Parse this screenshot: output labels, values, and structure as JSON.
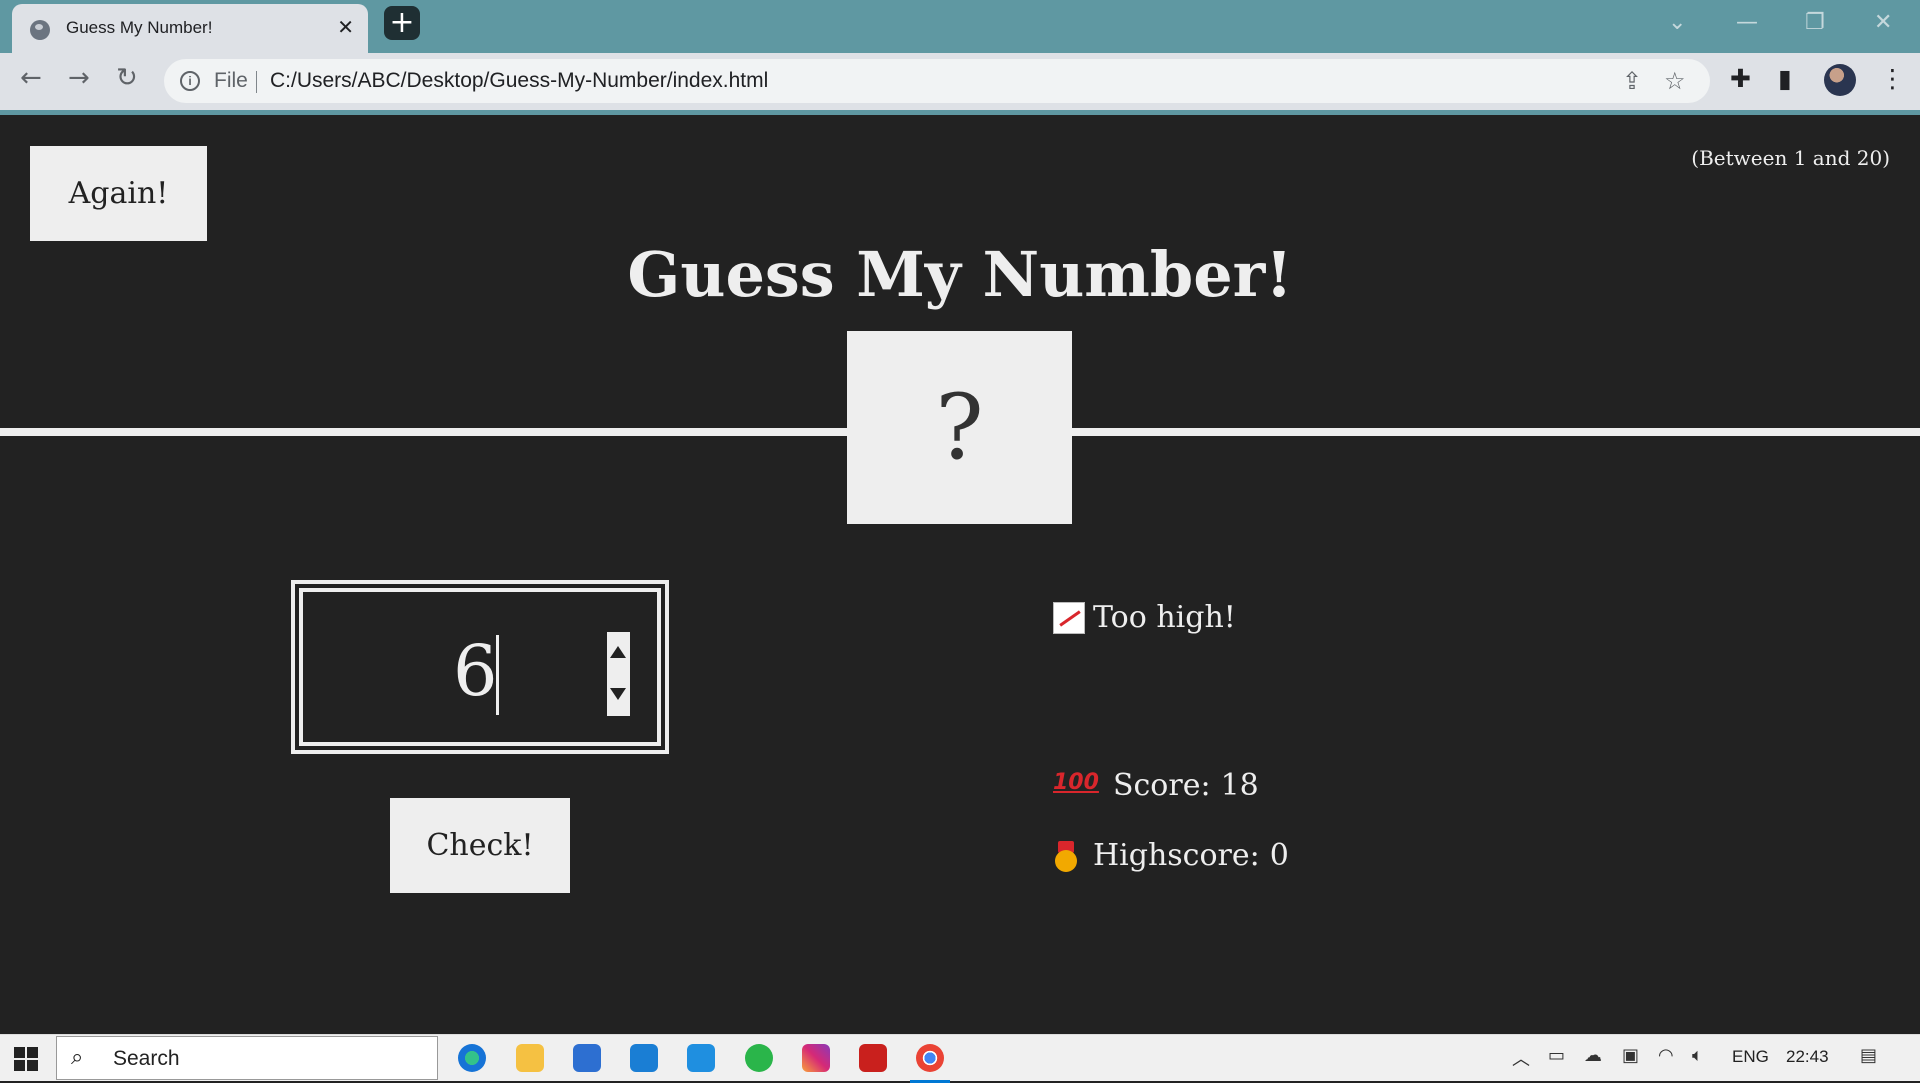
{
  "browser": {
    "tab_title": "Guess My Number!",
    "tab_close": "✕",
    "new_tab": "+",
    "window_controls": {
      "dropdown": "⌄",
      "minimize": "—",
      "restore": "❐",
      "close": "✕"
    },
    "nav": {
      "back": "←",
      "forward": "→",
      "reload": "↻"
    },
    "address": {
      "scheme_label": "File",
      "url": "C:/Users/ABC/Desktop/Guess-My-Number/index.html"
    },
    "toolbar_icons": [
      "share-icon",
      "star-icon",
      "extensions-icon",
      "side-panel-icon",
      "profile-avatar",
      "menu-icon"
    ]
  },
  "game": {
    "again_label": "Again!",
    "range_hint": "(Between 1 and 20)",
    "title": "Guess My Number!",
    "secret_display": "?",
    "guess_value": "6",
    "check_label": "Check!",
    "message": "Too high!",
    "score_label": "Score:",
    "score": "18",
    "highscore_label": "Highscore:",
    "highscore": "0",
    "colors": {
      "background": "#222222",
      "foreground": "#eeeeee"
    }
  },
  "taskbar": {
    "search_placeholder": "Search",
    "apps": [
      "edge-icon",
      "file-explorer-icon",
      "store-icon",
      "mail-icon",
      "vscode-icon",
      "whatsapp-icon",
      "instagram-icon",
      "acrobat-icon",
      "chrome-icon"
    ],
    "language": "ENG",
    "time": "22:43"
  }
}
